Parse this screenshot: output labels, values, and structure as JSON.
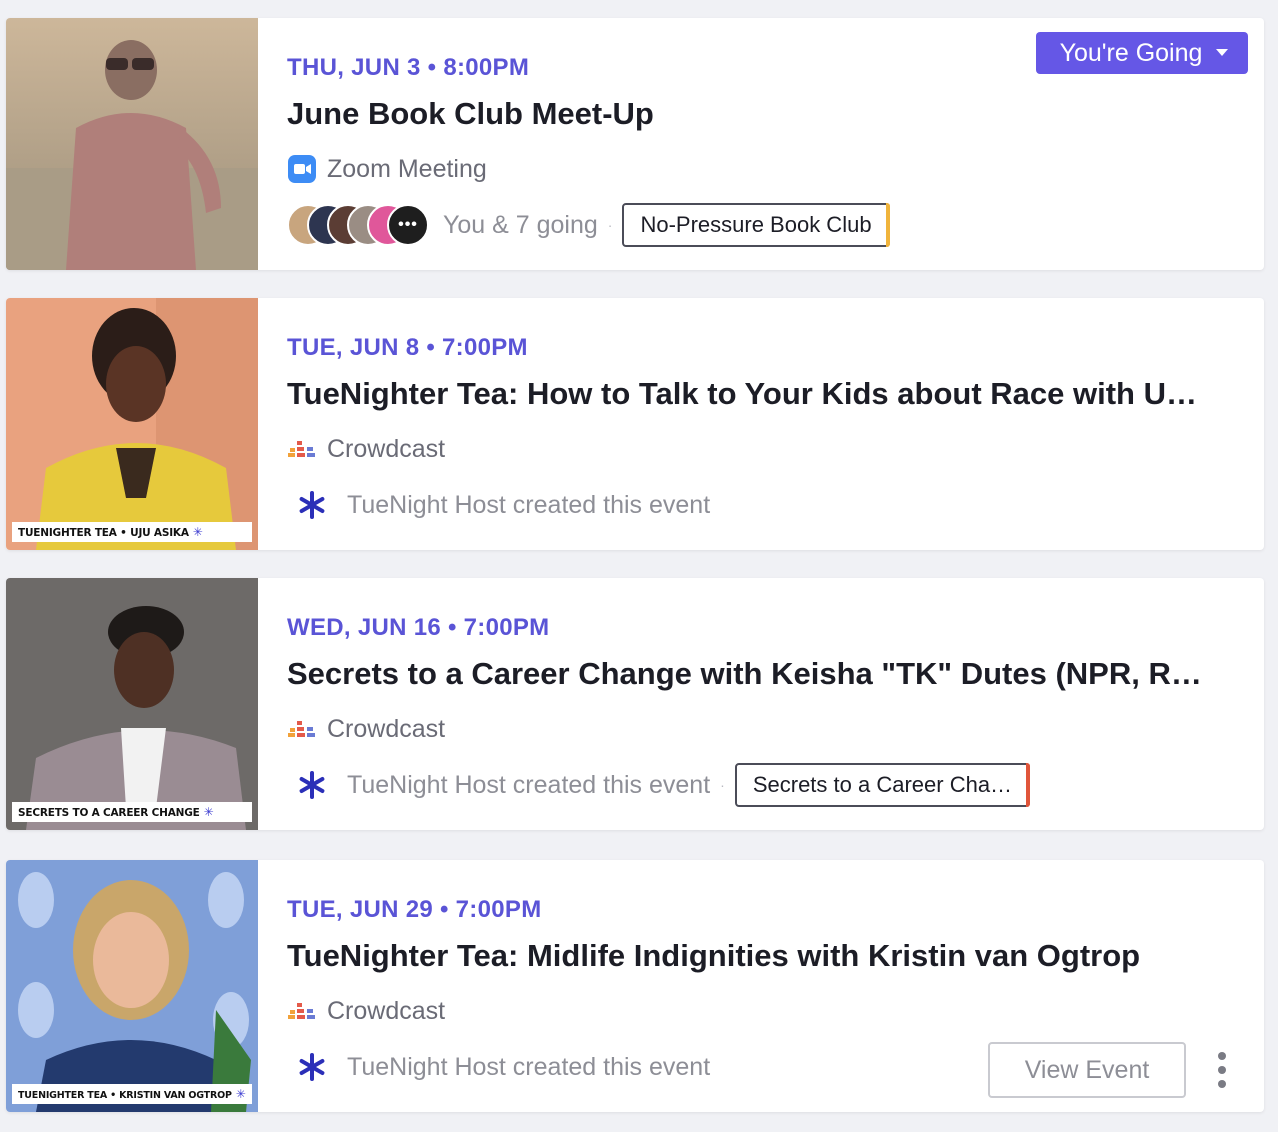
{
  "events": [
    {
      "date": "THU, JUN 3 • 8:00PM",
      "title": "June Book Club Meet-Up",
      "venue": {
        "label": "Zoom Meeting",
        "icon": "zoom-icon"
      },
      "attendance": "You & 7 going",
      "more_avatars": "•••",
      "tag": {
        "label": "No-Pressure Book Club",
        "color": "#f0b43c"
      },
      "rsvp_label": "You're Going",
      "thumb_caption": ""
    },
    {
      "date": "TUE, JUN 8 • 7:00PM",
      "title": "TueNighter Tea: How to Talk to Your Kids about Race with U…",
      "venue": {
        "label": "Crowdcast",
        "icon": "crowdcast-icon"
      },
      "host_text": "TueNight Host created this event",
      "thumb_caption": "TUENIGHTER TEA • UJU ASIKA"
    },
    {
      "date": "WED, JUN 16 • 7:00PM",
      "title": "Secrets to a Career Change with Keisha \"TK\" Dutes (NPR, R…",
      "venue": {
        "label": "Crowdcast",
        "icon": "crowdcast-icon"
      },
      "host_text": "TueNight Host created this event",
      "tag": {
        "label": "Secrets to a Career Cha…",
        "color": "#e0553a"
      },
      "thumb_caption": "SECRETS TO A CAREER CHANGE"
    },
    {
      "date": "TUE, JUN 29 • 7:00PM",
      "title": "TueNighter Tea: Midlife Indignities with Kristin van Ogtrop",
      "venue": {
        "label": "Crowdcast",
        "icon": "crowdcast-icon"
      },
      "host_text": "TueNight Host created this event",
      "view_label": "View Event",
      "thumb_caption": "TUENIGHTER TEA • KRISTIN VAN OGTROP"
    }
  ],
  "colors": {
    "accent": "#6557e6",
    "date": "#5a54d6"
  }
}
